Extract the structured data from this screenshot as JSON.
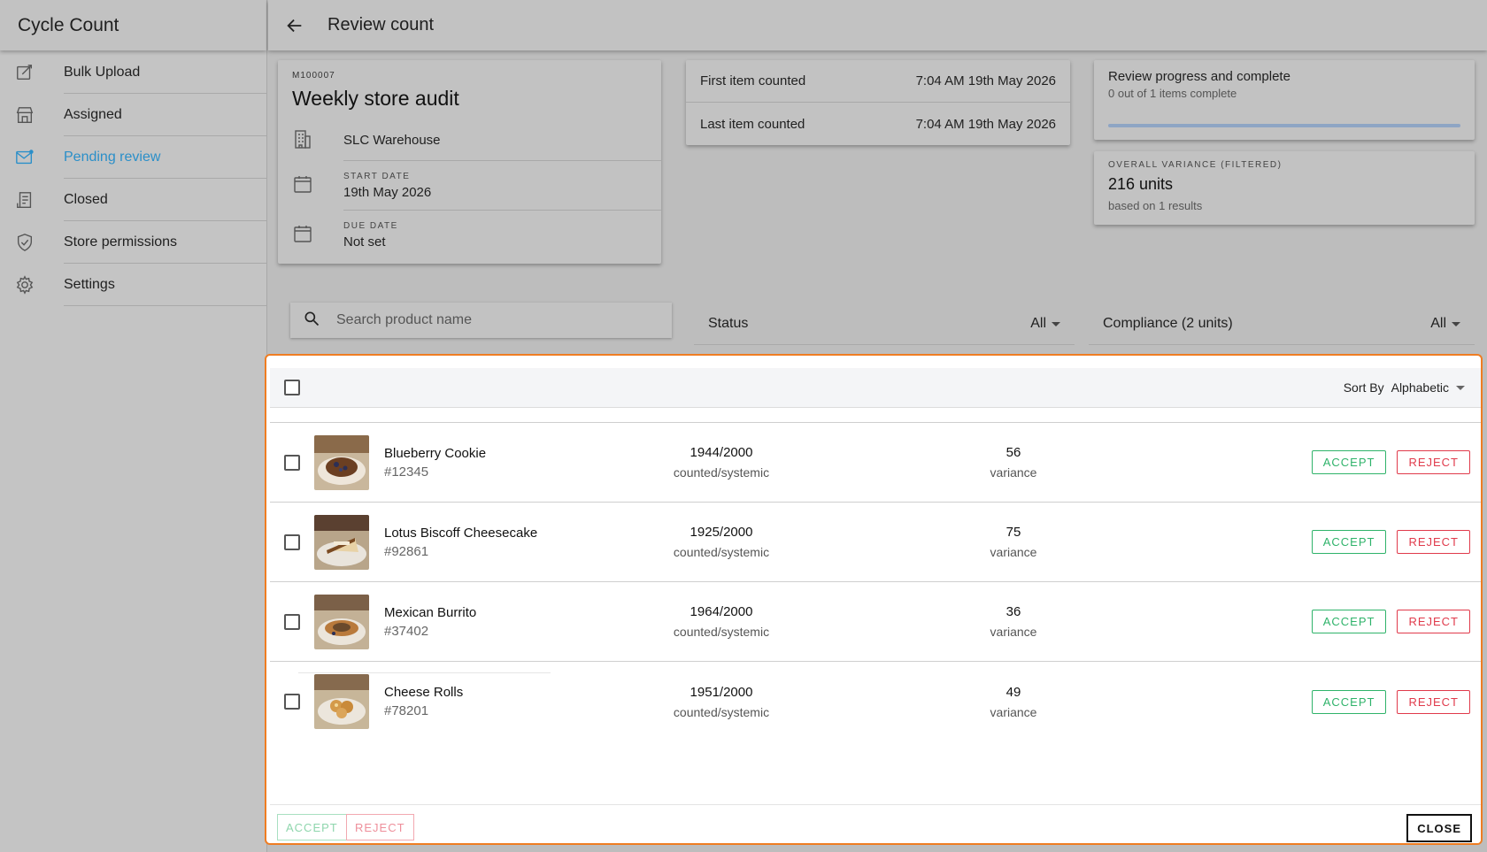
{
  "app": {
    "title": "Cycle Count"
  },
  "sidebar": {
    "items": [
      {
        "label": "Bulk Upload",
        "icon": "edit-icon",
        "active": false
      },
      {
        "label": "Assigned",
        "icon": "store-icon",
        "active": false
      },
      {
        "label": "Pending review",
        "icon": "mail-icon",
        "active": true
      },
      {
        "label": "Closed",
        "icon": "receipt-icon",
        "active": false
      },
      {
        "label": "Store permissions",
        "icon": "shield-icon",
        "active": false
      },
      {
        "label": "Settings",
        "icon": "gear-icon",
        "active": false
      }
    ]
  },
  "header": {
    "title": "Review count",
    "back_icon": "arrow-left-icon"
  },
  "audit": {
    "code": "M100007",
    "name": "Weekly store audit",
    "location": "SLC Warehouse",
    "start_label": "START DATE",
    "start_value": "19th May 2026",
    "due_label": "DUE DATE",
    "due_value": "Not set"
  },
  "timing": {
    "first_label": "First item counted",
    "first_value": "7:04 AM 19th May 2026",
    "last_label": "Last item counted",
    "last_value": "7:04 AM 19th May 2026"
  },
  "progress": {
    "title": "Review progress and complete",
    "subtitle": "0 out of 1 items complete",
    "fraction": 0
  },
  "variance": {
    "label": "OVERALL VARIANCE (FILTERED)",
    "value": "216 units",
    "sub": "based on 1 results"
  },
  "filters": {
    "search_placeholder": "Search product name",
    "status_label": "Status",
    "status_value": "All",
    "compliance_label": "Compliance (2 units)",
    "compliance_value": "All"
  },
  "table": {
    "sort_label": "Sort By",
    "sort_value": "Alphabetic",
    "rows": [
      {
        "name": "Blueberry Cookie",
        "sku": "#12345",
        "counted": "1944/2000",
        "counted_label": "counted/systemic",
        "variance": "56",
        "variance_label": "variance",
        "accept": "ACCEPT",
        "reject": "REJECT"
      },
      {
        "name": "Lotus Biscoff Cheesecake",
        "sku": "#92861",
        "counted": "1925/2000",
        "counted_label": "counted/systemic",
        "variance": "75",
        "variance_label": "variance",
        "accept": "ACCEPT",
        "reject": "REJECT"
      },
      {
        "name": "Mexican Burrito",
        "sku": "#37402",
        "counted": "1964/2000",
        "counted_label": "counted/systemic",
        "variance": "36",
        "variance_label": "variance",
        "accept": "ACCEPT",
        "reject": "REJECT"
      },
      {
        "name": "Cheese Rolls",
        "sku": "#78201",
        "counted": "1951/2000",
        "counted_label": "counted/systemic",
        "variance": "49",
        "variance_label": "variance",
        "accept": "ACCEPT",
        "reject": "REJECT"
      }
    ]
  },
  "footer": {
    "accept": "ACCEPT",
    "reject": "REJECT",
    "close": "CLOSE"
  },
  "colors": {
    "accent": "#2a8fc9",
    "accept": "#2fb36a",
    "reject": "#e03a4b",
    "highlight": "#ef7d22"
  }
}
